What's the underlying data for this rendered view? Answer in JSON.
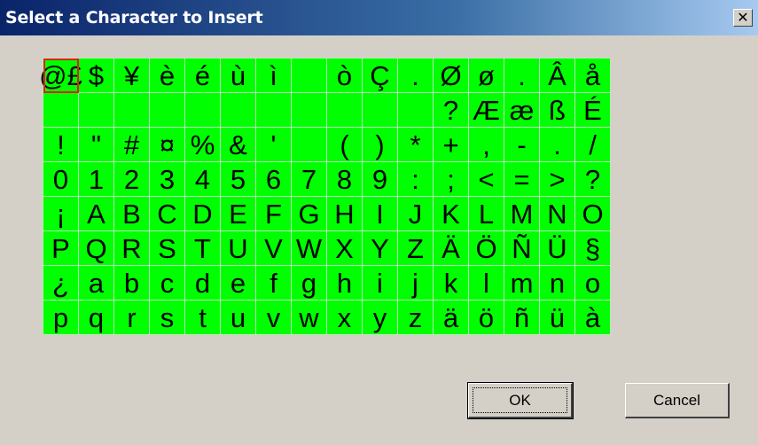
{
  "dialog": {
    "title": "Select a Character to Insert",
    "close_label": "✕"
  },
  "grid": {
    "rows": [
      [
        "@",
        "£",
        "$",
        "¥",
        "è",
        "é",
        "ù",
        "ì",
        "",
        "ò",
        "Ç",
        ".",
        "Ø",
        "ø",
        ".",
        "Â",
        "å"
      ],
      [
        "",
        "",
        "",
        "",
        "",
        "",
        "",
        "",
        "",
        "",
        "",
        "",
        "?",
        "Æ",
        "æ",
        "ß",
        "É"
      ],
      [
        "",
        "!",
        "\"",
        "#",
        "¤",
        "%",
        "&",
        "'",
        "",
        "(",
        ")",
        "*",
        "+",
        ",",
        "-",
        ".",
        "/"
      ],
      [
        "0",
        "1",
        "2",
        "3",
        "4",
        "5",
        "6",
        "7",
        "8",
        "9",
        ":",
        ";",
        "<",
        "=",
        ">",
        "?"
      ],
      [
        "¡",
        "A",
        "B",
        "C",
        "D",
        "E",
        "F",
        "G",
        "H",
        "I",
        "J",
        "K",
        "L",
        "M",
        "N",
        "O"
      ],
      [
        "P",
        "Q",
        "R",
        "S",
        "T",
        "U",
        "V",
        "W",
        "X",
        "Y",
        "Z",
        "Ä",
        "Ö",
        "Ñ",
        "Ü",
        "§"
      ],
      [
        "¿",
        "a",
        "b",
        "c",
        "d",
        "e",
        "f",
        "g",
        "h",
        "i",
        "j",
        "k",
        "l",
        "m",
        "n",
        "o"
      ],
      [
        "p",
        "q",
        "r",
        "s",
        "t",
        "u",
        "v",
        "w",
        "x",
        "y",
        "z",
        "ä",
        "ö",
        "ñ",
        "ü",
        "à"
      ]
    ],
    "selected": "@",
    "cell_color": "#00ff00",
    "selection_color": "#e02020"
  },
  "buttons": {
    "ok_label": "OK",
    "cancel_label": "Cancel"
  }
}
